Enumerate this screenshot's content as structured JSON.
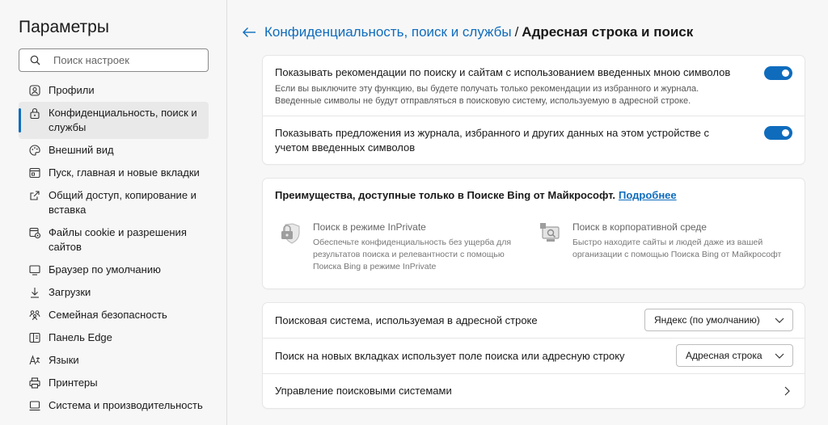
{
  "sidebar": {
    "title": "Параметры",
    "search_placeholder": "Поиск настроек",
    "items": [
      {
        "label": "Профили",
        "icon": "profile-icon"
      },
      {
        "label": "Конфиденциальность, поиск и службы",
        "icon": "lock-icon"
      },
      {
        "label": "Внешний вид",
        "icon": "palette-icon"
      },
      {
        "label": "Пуск, главная и новые вкладки",
        "icon": "home-tabs-icon"
      },
      {
        "label": "Общий доступ, копирование и вставка",
        "icon": "share-icon"
      },
      {
        "label": "Файлы cookie и разрешения сайтов",
        "icon": "cookie-icon"
      },
      {
        "label": "Браузер по умолчанию",
        "icon": "browser-icon"
      },
      {
        "label": "Загрузки",
        "icon": "download-icon"
      },
      {
        "label": "Семейная безопасность",
        "icon": "family-icon"
      },
      {
        "label": "Панель Edge",
        "icon": "edge-bar-icon"
      },
      {
        "label": "Языки",
        "icon": "language-icon"
      },
      {
        "label": "Принтеры",
        "icon": "printer-icon"
      },
      {
        "label": "Система и производительность",
        "icon": "system-icon"
      }
    ]
  },
  "header": {
    "parent": "Конфиденциальность, поиск и службы",
    "separator": "/",
    "current": "Адресная строка и поиск"
  },
  "suggestions": {
    "row1_title": "Показывать рекомендации по поиску и сайтам с использованием введенных мною символов",
    "row1_desc": "Если вы выключите эту функцию, вы будете получать только рекомендации из избранного и журнала. Введенные символы не будут отправляться в поисковую систему, используемую в адресной строке.",
    "row2_title": "Показывать предложения из журнала, избранного и других данных на этом устройстве с учетом введенных символов"
  },
  "bing": {
    "heading": "Преимущества, доступные только в Поиске Bing от Майкрософт.",
    "link": "Подробнее",
    "inprivate_title": "Поиск в режиме InPrivate",
    "inprivate_desc": "Обеспечьте конфиденциальность без ущерба для результатов поиска и релевантности с помощью Поиска Bing в режиме InPrivate",
    "enterprise_title": "Поиск в корпоративной среде",
    "enterprise_desc": "Быстро находите сайты и людей даже из вашей организации с помощью Поиска Bing от Майкрософт"
  },
  "search_engine": {
    "row1_label": "Поисковая система, используемая в адресной строке",
    "row1_value": "Яндекс (по умолчанию)",
    "row2_label": "Поиск на новых вкладках использует поле поиска или адресную строку",
    "row2_value": "Адресная строка",
    "row3_label": "Управление поисковыми системами"
  },
  "colors": {
    "accent": "#0f6cbd",
    "background": "#f7f7f7",
    "card": "#ffffff"
  }
}
